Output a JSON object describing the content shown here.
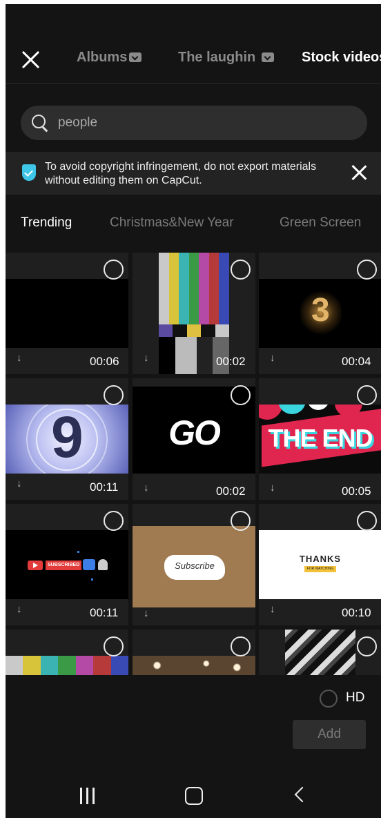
{
  "header": {
    "tabs": [
      {
        "label": "Albums",
        "has_dropdown": true,
        "active": false
      },
      {
        "label": "The laughin",
        "has_dropdown": true,
        "active": false
      },
      {
        "label": "Stock videos",
        "active": true
      }
    ]
  },
  "search": {
    "query": "people"
  },
  "notice": {
    "text": "To avoid copyright infringement, do not export materials without editing them on CapCut."
  },
  "categories": [
    "Trending",
    "Christmas&New Year",
    "Green Screen"
  ],
  "clips": [
    {
      "duration": "00:06",
      "thumb": "black frame"
    },
    {
      "duration": "00:02",
      "thumb": "tv color bars"
    },
    {
      "duration": "00:04",
      "thumb": "sparkling 3"
    },
    {
      "duration": "00:11",
      "thumb": "countdown 9"
    },
    {
      "duration": "00:02",
      "thumb": "GO",
      "text": "GO"
    },
    {
      "duration": "00:05",
      "thumb": "THE END",
      "text": "THE END"
    },
    {
      "duration": "00:11",
      "thumb": "subscribed button",
      "text": "SUBSCRIBED"
    },
    {
      "duration": "",
      "thumb": "paper subscribe",
      "text": "Subscribe"
    },
    {
      "duration": "00:10",
      "thumb": "thanks",
      "text": "THANKS",
      "subtext": "FOR WATCHING"
    },
    {
      "duration": "",
      "thumb": "color bars"
    },
    {
      "duration": "",
      "thumb": "bokeh"
    },
    {
      "duration": "",
      "thumb": "white streaks"
    }
  ],
  "footer": {
    "hd_label": "HD",
    "add_label": "Add"
  },
  "colors": {
    "background": "#141414",
    "accent": "#3ec6e8"
  },
  "icons": {
    "close": "close-icon",
    "search": "search-icon",
    "shield": "shield-icon",
    "download": "download-icon",
    "select": "select-circle-icon"
  }
}
